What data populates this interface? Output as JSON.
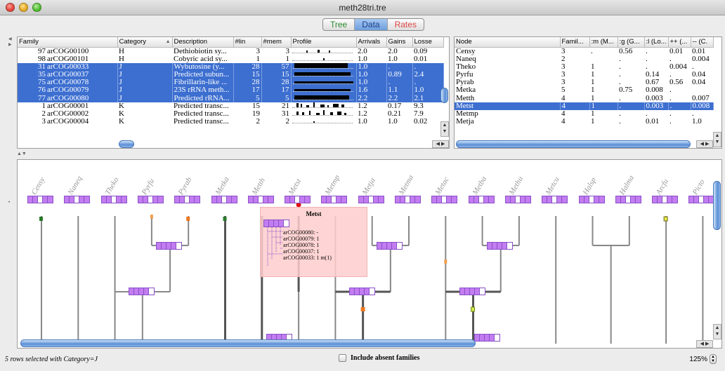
{
  "window": {
    "title": "meth28tri.tre"
  },
  "tabs": [
    {
      "label": "Tree",
      "color": "#2c8a2c"
    },
    {
      "label": "Data",
      "color": "#1e3f8a",
      "selected": true
    },
    {
      "label": "Rates",
      "color": "#dd4444"
    }
  ],
  "families_table": {
    "columns": [
      "Family",
      "Category",
      "Description",
      "#lin",
      "#mem",
      "Profile",
      "Arrivals",
      "Gains",
      "Losse"
    ],
    "sort_indicator": "▲",
    "rows": [
      {
        "idx": "97",
        "family": "arCOG00100",
        "category": "H",
        "description": "Dethiobiotin sy...",
        "lin": "3",
        "mem": "3",
        "arrivals": "2.0",
        "gains": "2.0",
        "losses": "0.09",
        "selected": false
      },
      {
        "idx": "98",
        "family": "arCOG00101",
        "category": "H",
        "description": "Cobyric acid sy...",
        "lin": "1",
        "mem": "1",
        "arrivals": "1.0",
        "gains": "1.0",
        "losses": "0.01",
        "selected": false
      },
      {
        "idx": "31",
        "family": "arCOG00033",
        "category": "J",
        "description": "Wybutosine (y...",
        "lin": "28",
        "mem": "57",
        "arrivals": "1.0",
        "gains": ".",
        "losses": ".",
        "selected": true
      },
      {
        "idx": "35",
        "family": "arCOG00037",
        "category": "J",
        "description": "Predicted subun...",
        "lin": "15",
        "mem": "15",
        "arrivals": "1.0",
        "gains": "0.89",
        "losses": "2.4",
        "selected": true
      },
      {
        "idx": "75",
        "family": "arCOG00078",
        "category": "J",
        "description": "Fibrillarin-like ...",
        "lin": "28",
        "mem": "28",
        "arrivals": "1.0",
        "gains": ".",
        "losses": ".",
        "selected": true
      },
      {
        "idx": "76",
        "family": "arCOG00079",
        "category": "J",
        "description": "23S rRNA meth...",
        "lin": "17",
        "mem": "17",
        "arrivals": "1.6",
        "gains": "1.1",
        "losses": "1.0",
        "selected": true
      },
      {
        "idx": "77",
        "family": "arCOG00080",
        "category": "J",
        "description": "Predicted rRNA...",
        "lin": "5",
        "mem": "5",
        "arrivals": "2.2",
        "gains": "2.2",
        "losses": "2.1",
        "selected": true
      },
      {
        "idx": "1",
        "family": "arCOG00001",
        "category": "K",
        "description": "Predicted transc...",
        "lin": "15",
        "mem": "21",
        "arrivals": "1.2",
        "gains": "0.17",
        "losses": "9.3",
        "selected": false
      },
      {
        "idx": "2",
        "family": "arCOG00002",
        "category": "K",
        "description": "Predicted transc...",
        "lin": "19",
        "mem": "31",
        "arrivals": "1.2",
        "gains": "0.21",
        "losses": "7.9",
        "selected": false
      },
      {
        "idx": "3",
        "family": "arCOG00004",
        "category": "K",
        "description": "Predicted transc...",
        "lin": "2",
        "mem": "2",
        "arrivals": "1.0",
        "gains": "1.0",
        "losses": "0.02",
        "selected": false
      }
    ]
  },
  "nodes_table": {
    "columns": [
      "Node",
      "Famil...",
      ":m (M...",
      ":g (G...",
      ":l (Lo...",
      "++ (...",
      "-- (C."
    ],
    "rows": [
      {
        "node": "Censy",
        "c1": "3",
        "c2": ".",
        "c3": "0.56",
        "c4": ".",
        "c5": "0.01",
        "c6": "0.01",
        "selected": false
      },
      {
        "node": "Naneq",
        "c1": "2",
        "c2": "",
        "c3": ".",
        "c4": ".",
        "c5": ".",
        "c6": "0.004",
        "selected": false
      },
      {
        "node": "Theko",
        "c1": "3",
        "c2": "1",
        "c3": ".",
        "c4": ".",
        "c5": "0.004",
        "c6": ".",
        "selected": false
      },
      {
        "node": "Pyrfu",
        "c1": "3",
        "c2": "1",
        "c3": ".",
        "c4": "0.14",
        "c5": ".",
        "c6": "0.04",
        "selected": false
      },
      {
        "node": "Pyrab",
        "c1": "3",
        "c2": "1",
        "c3": ".",
        "c4": "0.67",
        "c5": "0.56",
        "c6": "0.04",
        "selected": false
      },
      {
        "node": "Metka",
        "c1": "5",
        "c2": "1",
        "c3": "0.75",
        "c4": "0.008",
        "c5": ".",
        "c6": "",
        "selected": false
      },
      {
        "node": "Metth",
        "c1": "4",
        "c2": "1",
        "c3": ".",
        "c4": "0.003",
        "c5": ".",
        "c6": "0.007",
        "selected": false
      },
      {
        "node": "Metst",
        "c1": "4",
        "c2": "1",
        "c3": ".",
        "c4": "0.003",
        "c5": ".",
        "c6": "0.008",
        "selected": true
      },
      {
        "node": "Metmp",
        "c1": "4",
        "c2": "1",
        "c3": ".",
        "c4": ".",
        "c5": ".",
        "c6": ".",
        "selected": false
      },
      {
        "node": "Metja",
        "c1": "4",
        "c2": "1",
        "c3": ".",
        "c4": "0.01",
        "c5": ".",
        "c6": "1.0",
        "selected": false
      }
    ]
  },
  "tree": {
    "leaves": [
      "Censy",
      "Naneq",
      "Theko",
      "Pyrfu",
      "Pyrab",
      "Metka",
      "Metth",
      "Metst",
      "Metmp",
      "Metja",
      "Metma",
      "Metac",
      "Metba",
      "Methu",
      "Metcu",
      "Halsp",
      "Halma",
      "Arcfu",
      "Picto"
    ],
    "tooltip": {
      "title": "Metst",
      "rows": [
        "arCOG00080: -",
        "arCOG00079: 1",
        "arCOG00078: 1",
        "arCOG00037: 1",
        "arCOG00033: 1 m(1)"
      ]
    }
  },
  "status": {
    "selection": "5 rows selected with Category=J",
    "include_absent_label": "Include absent families",
    "include_absent_checked": false,
    "zoom": "125%"
  }
}
